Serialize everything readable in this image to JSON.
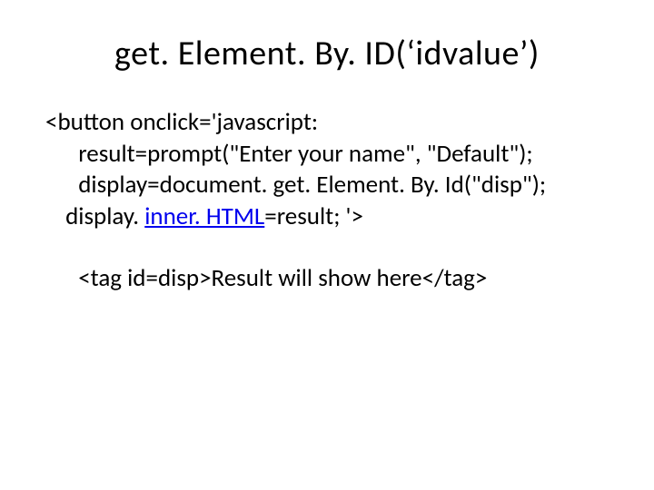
{
  "title": "get. Element. By. ID(‘idvalue’)",
  "code": {
    "l1": "<button onclick='javascript:",
    "l2": "  result=prompt(\"Enter your name\", \"Default\");",
    "l3": "  display=document. get. Element. By. Id(\"disp\");",
    "l4a": " display. ",
    "l4link": "inner. HTML",
    "l4b": "=result; '>",
    "l5": "  <tag id=disp>Result will show here</tag>"
  }
}
